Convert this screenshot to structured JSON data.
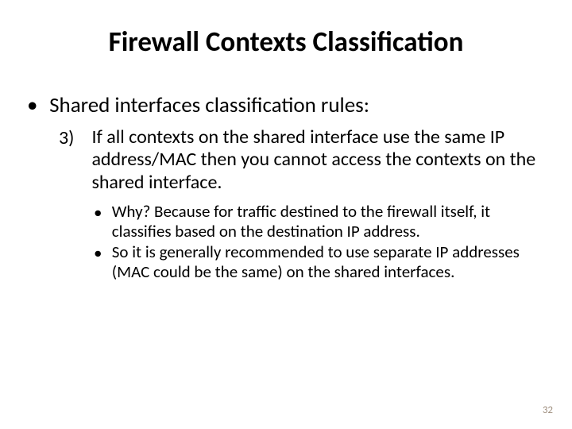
{
  "title": "Firewall Contexts Classification",
  "level1": {
    "bullet": "•",
    "text": "Shared interfaces classification rules:"
  },
  "level2": {
    "marker": "3)",
    "text": "If all contexts on the shared interface use the same IP address/MAC then you cannot access the contexts on the shared interface."
  },
  "level3a": {
    "bullet": "•",
    "text": "Why? Because for traffic destined to the firewall itself, it classifies based on the destination IP address."
  },
  "level3b": {
    "bullet": "•",
    "text": "So it is generally recommended to use separate IP addresses (MAC could be the same) on the shared interfaces."
  },
  "pageNumber": "32"
}
